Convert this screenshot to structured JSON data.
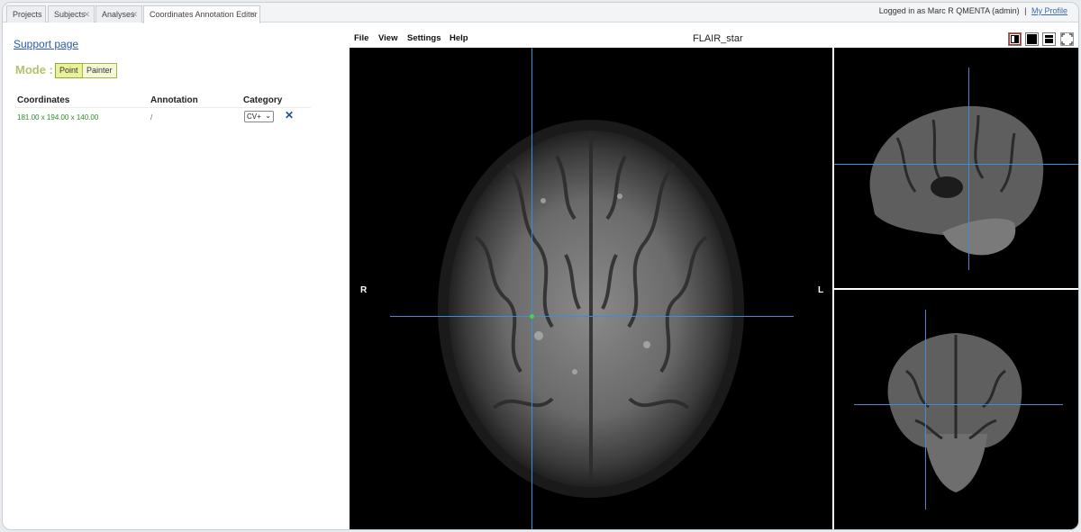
{
  "tabs": [
    {
      "label": "Projects",
      "closable": false
    },
    {
      "label": "Subjects",
      "closable": true
    },
    {
      "label": "Analyses",
      "closable": true
    },
    {
      "label": "Coordinates Annotation Editor",
      "closable": true,
      "active": true
    }
  ],
  "header": {
    "logged_in_text": "Logged in as  Marc R QMENTA (admin)",
    "separator": "|",
    "profile_link": "My Profile"
  },
  "left": {
    "support_link": "Support page",
    "mode_label": "Mode :",
    "mode_buttons": [
      "Point",
      "Painter"
    ],
    "mode_active": "Point",
    "table": {
      "headers": [
        "Coordinates",
        "Annotation",
        "Category"
      ],
      "rows": [
        {
          "coordinates": "181.00 x 194.00 x 140.00",
          "annotation": "/",
          "category": "CV+"
        }
      ]
    }
  },
  "viewer": {
    "menu": [
      "File",
      "View",
      "Settings",
      "Help"
    ],
    "title": "FLAIR_star",
    "tools": [
      "contrast-icon",
      "black-square-icon",
      "layout-icon",
      "fullscreen-icon"
    ],
    "orient_left": "R",
    "orient_right": "L",
    "crosshair_color": "#3a8fd6"
  },
  "colors": {
    "accent_mode": "#b2c36b",
    "link": "#2a5aa8",
    "coordinate_text": "#2b8c2b"
  }
}
